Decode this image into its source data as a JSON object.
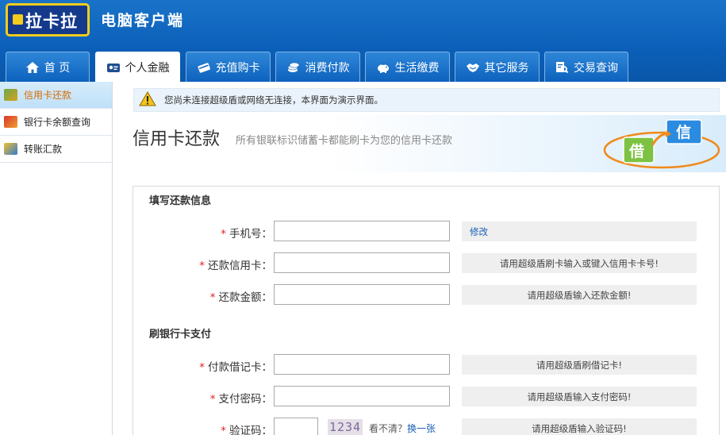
{
  "header": {
    "logo_text": "拉卡拉",
    "app_title": "电脑客户端"
  },
  "tabs": [
    {
      "label": "首 页",
      "icon": "home-icon"
    },
    {
      "label": "个人金融",
      "icon": "id-card-icon"
    },
    {
      "label": "充值购卡",
      "icon": "card-icon"
    },
    {
      "label": "消费付款",
      "icon": "coins-icon"
    },
    {
      "label": "生活缴费",
      "icon": "piggy-bank-icon"
    },
    {
      "label": "其它服务",
      "icon": "handshake-icon"
    },
    {
      "label": "交易查询",
      "icon": "search-document-icon"
    }
  ],
  "sidebar": {
    "items": [
      {
        "label": "信用卡还款",
        "icon": "credit-card-icon"
      },
      {
        "label": "银行卡余额查询",
        "icon": "bank-card-icon"
      },
      {
        "label": "转账汇款",
        "icon": "transfer-icon"
      }
    ]
  },
  "notice": {
    "text": "您尚未连接超级盾或网络无连接，本界面为演示界面。"
  },
  "page": {
    "title": "信用卡还款",
    "subtitle": "所有银联标识储蓄卡都能刷卡为您的信用卡还款",
    "logo_debit": "借",
    "logo_credit": "信"
  },
  "form": {
    "section1_title": "填写还款信息",
    "phone_label": "手机号：",
    "phone_hint": "修改",
    "card_label": "还款信用卡：",
    "card_hint": "请用超级盾刷卡输入或键入信用卡卡号!",
    "amount_label": "还款金额：",
    "amount_hint": "请用超级盾输入还款金额!",
    "section2_title": "刷银行卡支付",
    "debit_label": "付款借记卡：",
    "debit_hint": "请用超级盾刷借记卡!",
    "password_label": "支付密码：",
    "password_hint": "请用超级盾输入支付密码!",
    "captcha_label": "验证码：",
    "captcha_code": "1234",
    "captcha_prompt": "看不清？",
    "captcha_refresh": "换一张",
    "captcha_hint": "请用超级盾输入验证码!",
    "required_mark": "*"
  },
  "colors": {
    "header_blue": "#0b5fb8",
    "accent_yellow": "#f4cc1d",
    "required_red": "#e02020",
    "link_blue": "#1a5fb4",
    "active_side_text": "#d86b00"
  }
}
